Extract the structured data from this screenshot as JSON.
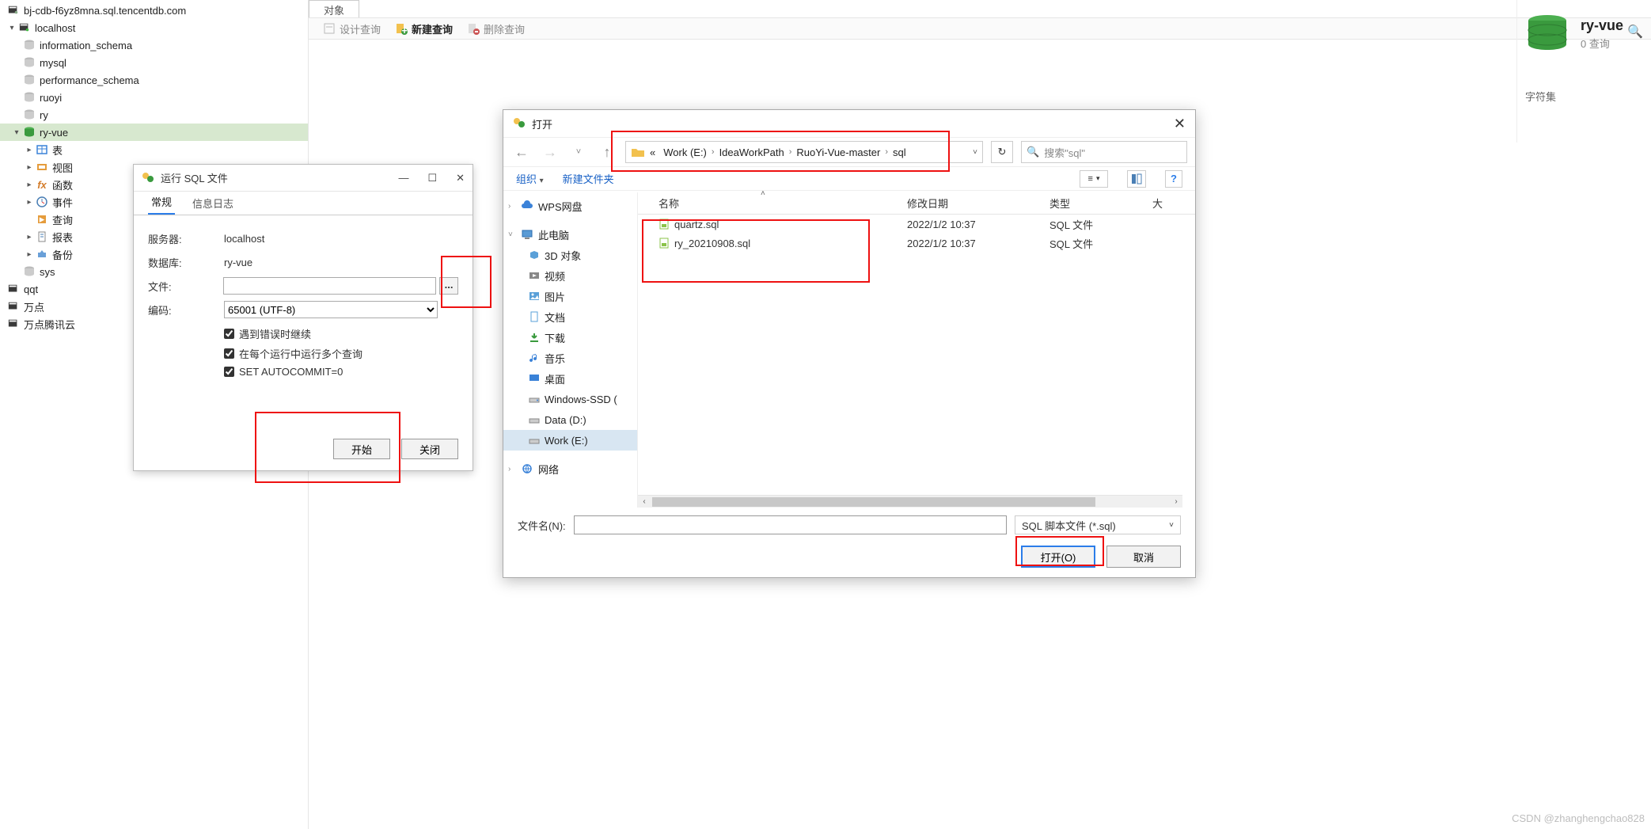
{
  "tree": {
    "conn1": "bj-cdb-f6yz8mna.sql.tencentdb.com",
    "conn2": "localhost",
    "db1": "information_schema",
    "db2": "mysql",
    "db3": "performance_schema",
    "db4": "ruoyi",
    "db5": "ry",
    "db6": "ry-vue",
    "node_table": "表",
    "node_view": "视图",
    "node_func": "函数",
    "node_event": "事件",
    "node_query": "查询",
    "node_report": "报表",
    "node_backup": "备份",
    "db7": "sys",
    "conn3": "qqt",
    "conn4": "万点",
    "conn5": "万点腾讯云"
  },
  "maintab": "对象",
  "toolbar": {
    "design": "设计查询",
    "new": "新建查询",
    "delete": "删除查询"
  },
  "info": {
    "title": "ry-vue",
    "sub": "0 查询",
    "charset_label": "字符集"
  },
  "dlg": {
    "title": "运行 SQL 文件",
    "tab_general": "常规",
    "tab_log": "信息日志",
    "server_k": "服务器:",
    "server_v": "localhost",
    "db_k": "数据库:",
    "db_v": "ry-vue",
    "file_k": "文件:",
    "enc_k": "编码:",
    "enc_v": "65001 (UTF-8)",
    "chk1": "遇到错误时继续",
    "chk2": "在每个运行中运行多个查询",
    "chk3": "SET AUTOCOMMIT=0",
    "start": "开始",
    "close": "关闭",
    "browse": "..."
  },
  "open": {
    "title": "打开",
    "crumbs": {
      "laquo": "«",
      "c1": "Work (E:)",
      "c2": "IdeaWorkPath",
      "c3": "RuoYi-Vue-master",
      "c4": "sql"
    },
    "search_placeholder": "搜索\"sql\"",
    "org": "组织",
    "newfolder": "新建文件夹",
    "nav": {
      "wps": "WPS网盘",
      "pc": "此电脑",
      "obj3d": "3D 对象",
      "video": "视频",
      "pics": "图片",
      "docs": "文档",
      "dl": "下载",
      "music": "音乐",
      "desktop": "桌面",
      "winssd": "Windows-SSD (",
      "datad": "Data (D:)",
      "worke": "Work (E:)",
      "net": "网络"
    },
    "hdr": {
      "name": "名称",
      "date": "修改日期",
      "type": "类型",
      "size": "大"
    },
    "files": [
      {
        "name": "quartz.sql",
        "date": "2022/1/2 10:37",
        "type": "SQL 文件"
      },
      {
        "name": "ry_20210908.sql",
        "date": "2022/1/2 10:37",
        "type": "SQL 文件"
      }
    ],
    "fn_label": "文件名(N):",
    "filter": "SQL 脚本文件 (*.sql)",
    "open_btn": "打开(O)",
    "cancel_btn": "取消"
  },
  "watermark": "CSDN @zhanghengchao828"
}
